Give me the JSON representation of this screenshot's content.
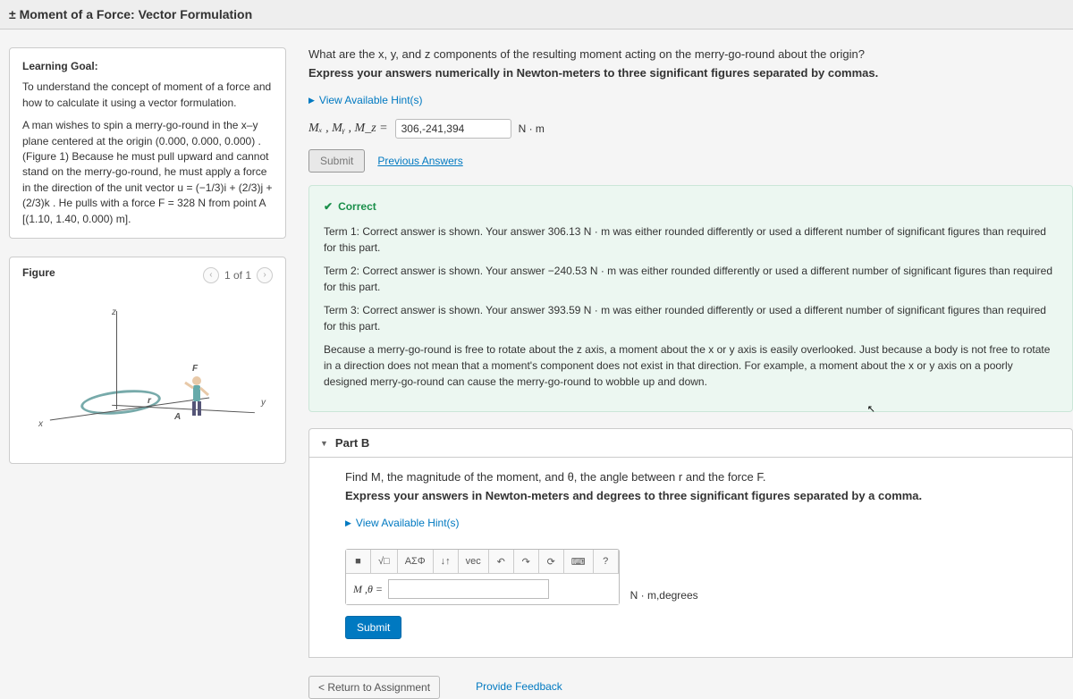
{
  "page": {
    "title": "± Moment of a Force: Vector Formulation"
  },
  "learning": {
    "heading": "Learning Goal:",
    "goal": "To understand the concept of moment of a force and how to calculate it using a vector formulation.",
    "scenario": "A man wishes to spin a merry-go-round in the x–y plane centered at the origin (0.000, 0.000, 0.000) . (Figure 1) Because he must pull upward and cannot stand on the merry-go-round, he must apply a force in the direction of the unit vector u = (−1/3)i + (2/3)j + (2/3)k . He pulls with a force F = 328 N from point A [(1.10, 1.40, 0.000) m]."
  },
  "figure": {
    "label": "Figure",
    "pager": "1 of 1",
    "axis_x": "x",
    "axis_y": "y",
    "axis_z": "z",
    "pt_A": "A",
    "pt_F": "F",
    "pt_r": "r"
  },
  "partA": {
    "q1": "What are the x, y, and z components of the resulting moment acting on the merry-go-round about the origin?",
    "q2": "Express your answers numerically in Newton-meters to three significant figures separated by commas.",
    "hint": "View Available Hint(s)",
    "var": "Mₓ , Mᵧ , M_z  =",
    "value": "306,-241,394",
    "units": "N · m",
    "submit": "Submit",
    "prev": "Previous Answers"
  },
  "feedback": {
    "correct": "Correct",
    "t1": "Term 1: Correct answer is shown. Your answer 306.13 N · m was either rounded differently or used a different number of significant figures than required for this part.",
    "t2": "Term 2: Correct answer is shown. Your answer −240.53 N · m was either rounded differently or used a different number of significant figures than required for this part.",
    "t3": "Term 3: Correct answer is shown. Your answer 393.59 N · m was either rounded differently or used a different number of significant figures than required for this part.",
    "explain": "Because a merry-go-round is free to rotate about the z axis, a moment about the x or y axis is easily overlooked. Just because a body is not free to rotate in a direction does not mean that a moment's component does not exist in that direction. For example, a moment about the x or y axis on a poorly designed merry-go-round can cause the merry-go-round to wobble up and down."
  },
  "partB": {
    "header": "Part B",
    "q1": "Find M, the magnitude of the moment, and θ, the angle between r and the force F.",
    "q2": "Express your answers in Newton-meters and degrees to three significant figures separated by a comma.",
    "hint": "View Available Hint(s)",
    "label": "M ,θ =",
    "units": "N · m,degrees",
    "submit": "Submit",
    "tools": {
      "t1": "■",
      "t2": "√□",
      "t3": "ΑΣΦ",
      "t4": "↓↑",
      "t5": "vec",
      "t6": "↶",
      "t7": "↷",
      "t8": "⟳",
      "t9": "⌨",
      "t10": "?"
    }
  },
  "footer": {
    "return": "< Return to Assignment",
    "feedback": "Provide Feedback"
  }
}
